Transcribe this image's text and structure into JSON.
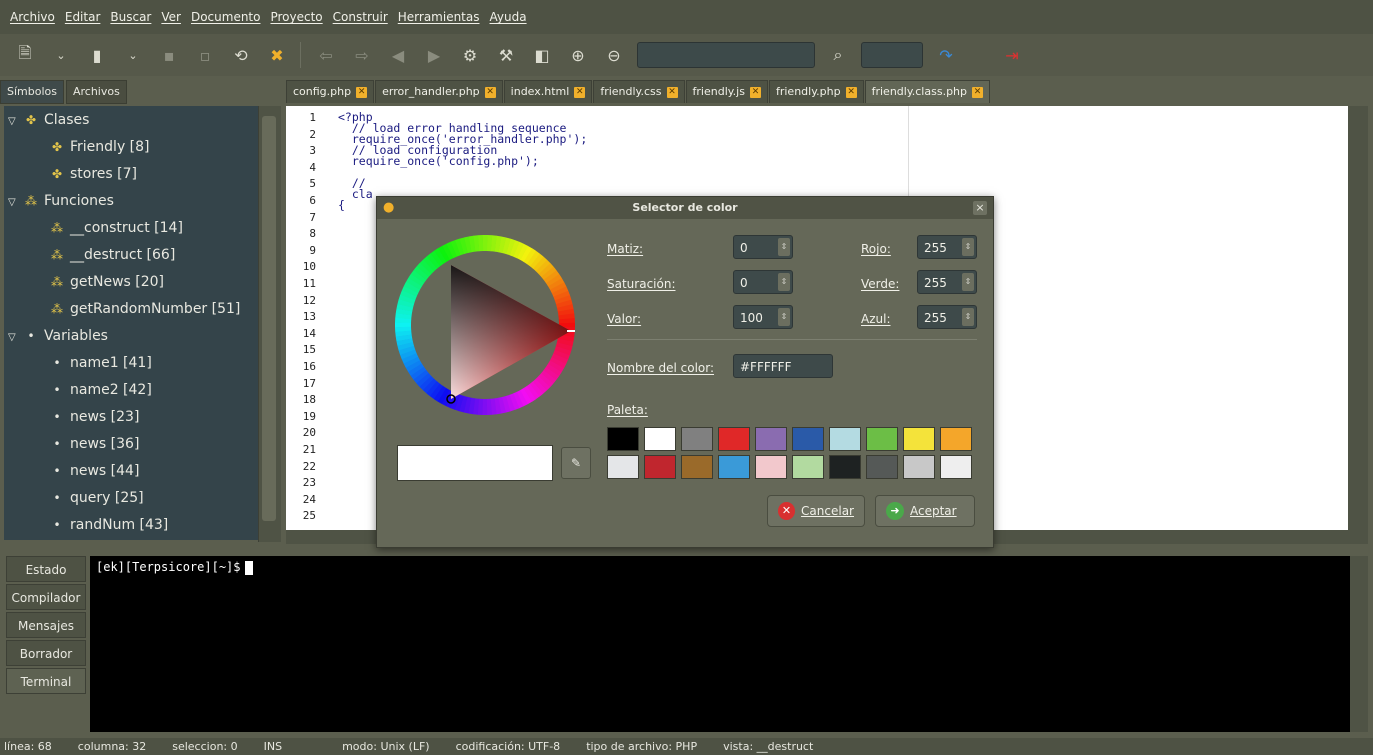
{
  "menu": [
    "Archivo",
    "Editar",
    "Buscar",
    "Ver",
    "Documento",
    "Proyecto",
    "Construir",
    "Herramientas",
    "Ayuda"
  ],
  "sidebar": {
    "tabs": [
      "Símbolos",
      "Archivos"
    ],
    "tree": [
      {
        "label": "Clases",
        "level": 0,
        "icon": "class-icon"
      },
      {
        "label": "Friendly [8]",
        "level": 1,
        "icon": "class-icon"
      },
      {
        "label": "stores [7]",
        "level": 1,
        "icon": "class-icon"
      },
      {
        "label": "Funciones",
        "level": 0,
        "icon": "function-icon"
      },
      {
        "label": "__construct [14]",
        "level": 1,
        "icon": "function-icon"
      },
      {
        "label": "__destruct [66]",
        "level": 1,
        "icon": "function-icon"
      },
      {
        "label": "getNews [20]",
        "level": 1,
        "icon": "function-icon"
      },
      {
        "label": "getRandomNumber [51]",
        "level": 1,
        "icon": "function-icon"
      },
      {
        "label": "Variables",
        "level": 0,
        "icon": "variable-icon"
      },
      {
        "label": "name1 [41]",
        "level": 1,
        "icon": "variable-icon"
      },
      {
        "label": "name2 [42]",
        "level": 1,
        "icon": "variable-icon"
      },
      {
        "label": "news [23]",
        "level": 1,
        "icon": "variable-icon"
      },
      {
        "label": "news [36]",
        "level": 1,
        "icon": "variable-icon"
      },
      {
        "label": "news [44]",
        "level": 1,
        "icon": "variable-icon"
      },
      {
        "label": "query [25]",
        "level": 1,
        "icon": "variable-icon"
      },
      {
        "label": "randNum [43]",
        "level": 1,
        "icon": "variable-icon"
      }
    ]
  },
  "editor": {
    "tabs": [
      "config.php",
      "error_handler.php",
      "index.html",
      "friendly.css",
      "friendly.js",
      "friendly.php",
      "friendly.class.php"
    ],
    "active_tab": "friendly.class.php",
    "line_numbers": [
      "1",
      "2",
      "3",
      "4",
      "5",
      "6",
      "7",
      "8",
      "9",
      "10",
      "11",
      "12",
      "13",
      "14",
      "15",
      "16",
      "17",
      "18",
      "19",
      "20",
      "21",
      "22",
      "23",
      "24",
      "25"
    ],
    "lines": [
      {
        "n": 1,
        "text": "<?php",
        "cls": ""
      },
      {
        "n": 2,
        "text": "  // load error handling sequence",
        "cls": "cmt"
      },
      {
        "n": 3,
        "text": "  require_once('error_handler.php');",
        "cls": ""
      },
      {
        "n": 4,
        "text": "  // load configuration",
        "cls": "cmt"
      },
      {
        "n": 5,
        "text": "  require_once('config.php');",
        "cls": ""
      },
      {
        "n": 7,
        "text": "  //",
        "cls": "cmt"
      },
      {
        "n": 8,
        "text": "  cla",
        "cls": ""
      },
      {
        "n": 9,
        "text": "{",
        "cls": ""
      }
    ]
  },
  "dialog": {
    "title": "Selector de color",
    "hue_label": "Matiz:",
    "hue_value": "0",
    "sat_label": "Saturación:",
    "sat_value": "0",
    "val_label": "Valor:",
    "val_value": "100",
    "red_label": "Rojo:",
    "red_value": "255",
    "green_label": "Verde:",
    "green_value": "255",
    "blue_label": "Azul:",
    "blue_value": "255",
    "name_label": "Nombre del color:",
    "name_value": "#FFFFFF",
    "palette_label": "Paleta:",
    "palette": [
      "#000000",
      "#ffffff",
      "#808080",
      "#e02828",
      "#8a6cb0",
      "#2a5aa8",
      "#b4dbe2",
      "#6cbe46",
      "#f4e33a",
      "#f4a62a",
      "#e4e6e8",
      "#c0262e",
      "#9a6a2a",
      "#3a9ad8",
      "#f2c8cc",
      "#b2daa0",
      "#1e2222",
      "#555957",
      "#c8c8c8",
      "#eeeeee"
    ],
    "cancel_label": "Cancelar",
    "accept_label": "Aceptar"
  },
  "bottom": {
    "tabs": [
      "Estado",
      "Compilador",
      "Mensajes",
      "Borrador",
      "Terminal"
    ],
    "active_tab": "Terminal",
    "terminal_prompt": "[ek][Terpsicore][~]$"
  },
  "status": {
    "line": "línea: 68",
    "column": "columna: 32",
    "selection": "seleccion: 0",
    "mode": "INS",
    "eol": "modo: Unix (LF)",
    "encoding": "codificación: UTF-8",
    "filetype": "tipo de archivo: PHP",
    "scope": "vista: __destruct"
  },
  "colors": {
    "accent_close": "#f1b02b",
    "terminal_bg": "#000000",
    "selected_color": "#FFFFFF"
  }
}
